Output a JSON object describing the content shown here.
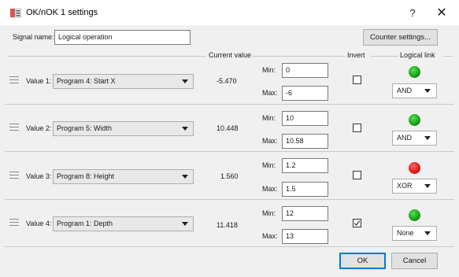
{
  "window": {
    "title": "OK/nOK 1 settings",
    "help": "?",
    "close": "✕"
  },
  "signal": {
    "label": "Signal name:",
    "value": "Logical operation"
  },
  "counter_button": "Counter settings...",
  "headers": {
    "current_value": "Current value",
    "invert": "Invert",
    "logical_link": "Logical link"
  },
  "min_label": "Min:",
  "max_label": "Max:",
  "rows": [
    {
      "label": "Value 1:",
      "program": "Program 4: Start X",
      "current": "-5.470",
      "min": "0",
      "max": "-6",
      "invert": false,
      "led": "green",
      "link": "AND"
    },
    {
      "label": "Value 2:",
      "program": "Program 5: Width",
      "current": "10.448",
      "min": "10",
      "max": "10.58",
      "invert": false,
      "led": "green",
      "link": "AND"
    },
    {
      "label": "Value 3:",
      "program": "Program 8: Height",
      "current": "1.560",
      "min": "1.2",
      "max": "1.5",
      "invert": false,
      "led": "red",
      "link": "XOR"
    },
    {
      "label": "Value 4:",
      "program": "Program 1: Depth",
      "current": "11.418",
      "min": "12",
      "max": "13",
      "invert": true,
      "led": "green",
      "link": "None"
    }
  ],
  "buttons": {
    "ok": "OK",
    "cancel": "Cancel"
  }
}
